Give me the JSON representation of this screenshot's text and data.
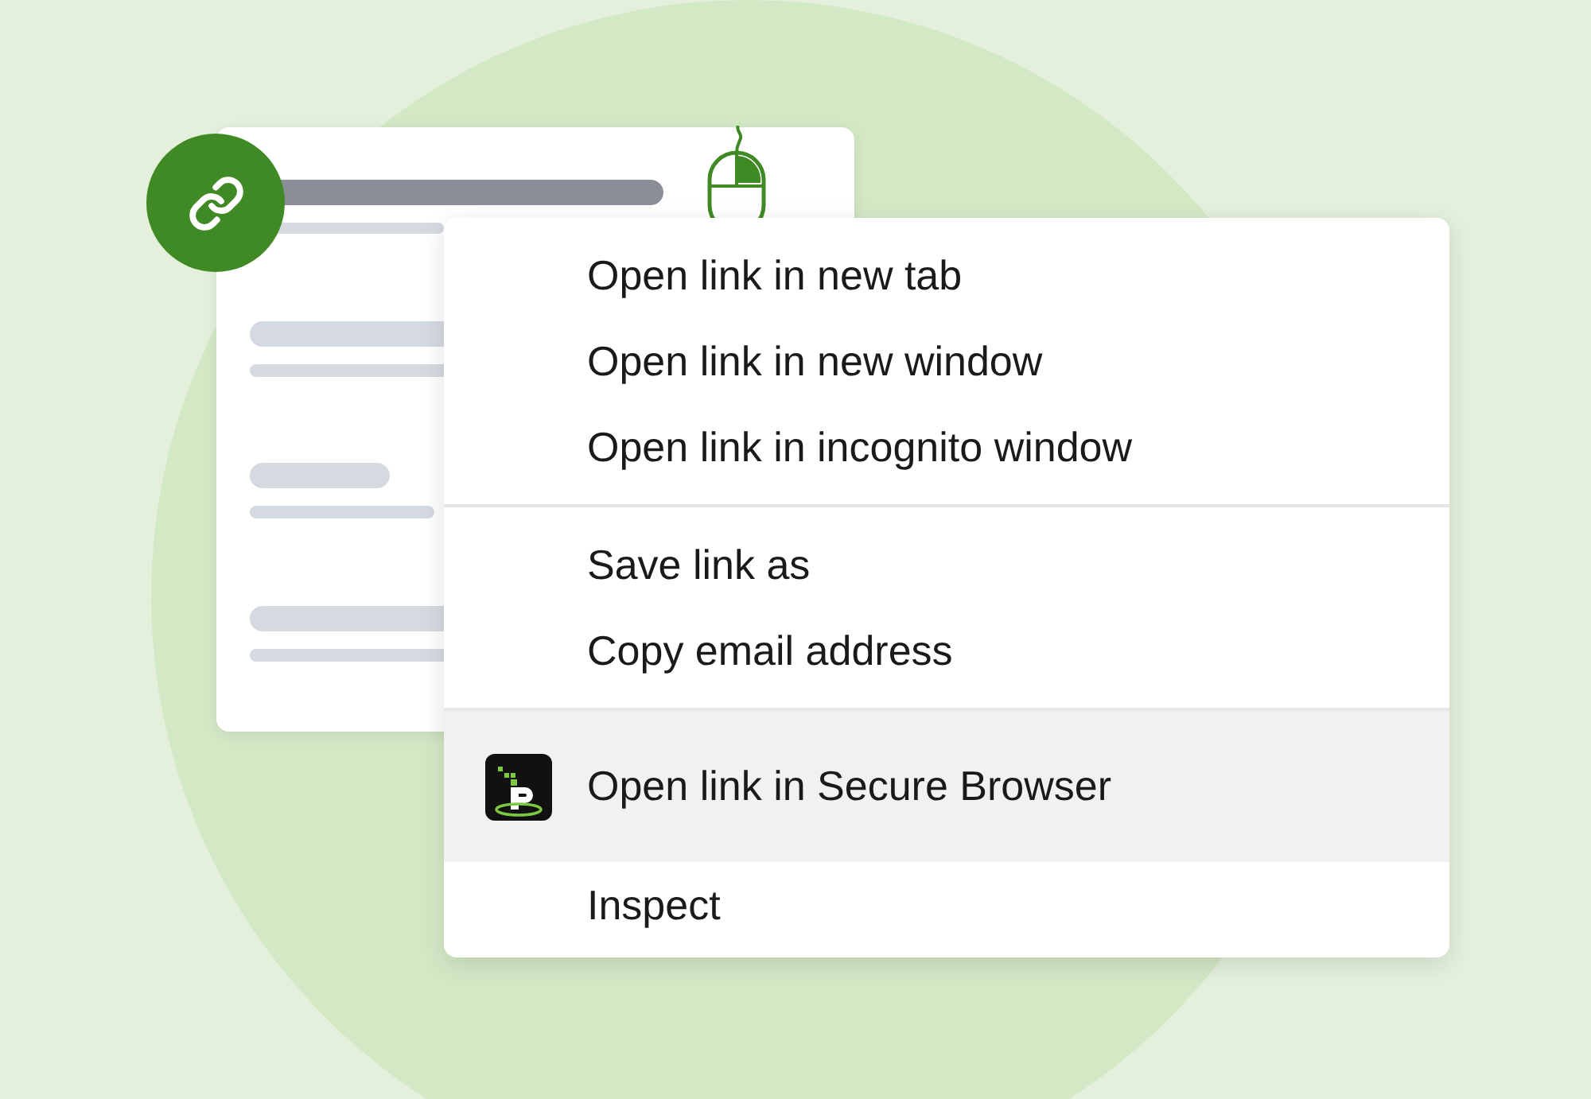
{
  "menu": {
    "groups": [
      {
        "items": [
          {
            "label": "Open link in new tab",
            "selected": false,
            "kind": "plain"
          },
          {
            "label": "Open link in new window",
            "selected": false,
            "kind": "plain"
          },
          {
            "label": "Open link in incognito window",
            "selected": false,
            "kind": "plain"
          }
        ]
      },
      {
        "items": [
          {
            "label": "Save link as",
            "selected": false,
            "kind": "plain"
          },
          {
            "label": "Copy email address",
            "selected": false,
            "kind": "plain"
          }
        ]
      },
      {
        "items": [
          {
            "label": "Open link in Secure Browser",
            "selected": true,
            "kind": "app"
          },
          {
            "label": "Inspect",
            "selected": false,
            "kind": "plain"
          }
        ]
      }
    ]
  }
}
